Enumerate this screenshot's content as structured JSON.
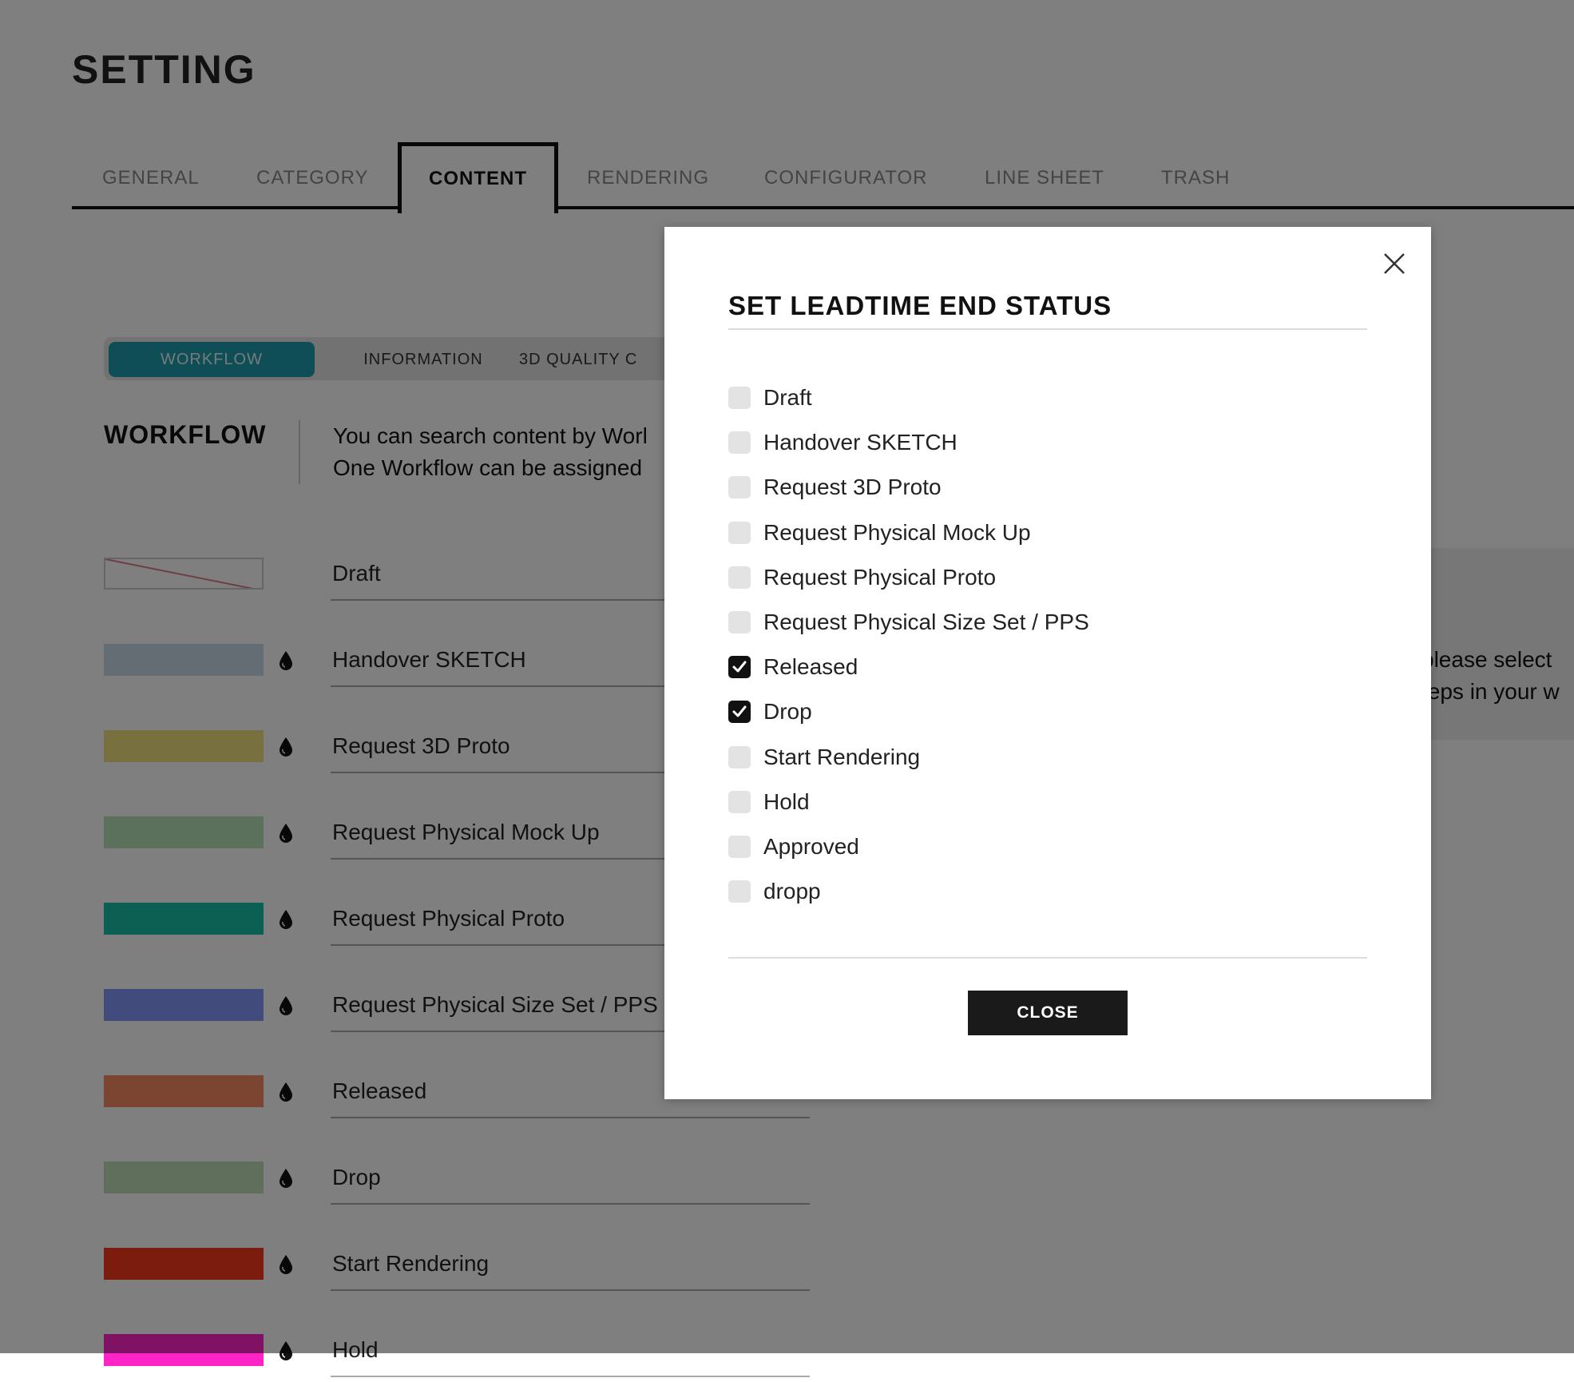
{
  "page": {
    "title": "SETTING"
  },
  "tabs": [
    {
      "label": "GENERAL"
    },
    {
      "label": "CATEGORY"
    },
    {
      "label": "CONTENT"
    },
    {
      "label": "RENDERING"
    },
    {
      "label": "CONFIGURATOR"
    },
    {
      "label": "LINE SHEET"
    },
    {
      "label": "TRASH"
    }
  ],
  "active_tab": "CONTENT",
  "subtabs": [
    {
      "label": "WORKFLOW"
    },
    {
      "label": "INFORMATION"
    },
    {
      "label": "3D QUALITY C"
    }
  ],
  "active_subtab": "WORKFLOW",
  "section": {
    "title": "WORKFLOW",
    "desc_line1": "You can search content by Worl",
    "desc_line2": "One Workflow can be assigned"
  },
  "info": {
    "line1": "please select",
    "line2": "teps in your w"
  },
  "workflow_items": [
    {
      "label": "Draft",
      "color": "#ffffff"
    },
    {
      "label": "Handover SKETCH",
      "color": "#c8d9e8"
    },
    {
      "label": "Request 3D Proto",
      "color": "#f1e07e"
    },
    {
      "label": "Request Physical Mock Up",
      "color": "#b6e3b6"
    },
    {
      "label": "Request Physical Proto",
      "color": "#18c0a6"
    },
    {
      "label": "Request Physical Size Set / PPS",
      "color": "#8298f9"
    },
    {
      "label": "Released",
      "color": "#f98a62"
    },
    {
      "label": "Drop",
      "color": "#c0dcb8"
    },
    {
      "label": "Start Rendering",
      "color": "#f8381e"
    },
    {
      "label": "Hold",
      "color": "#ff24c6"
    }
  ],
  "modal": {
    "title": "SET LEADTIME END STATUS",
    "options": [
      {
        "label": "Draft",
        "checked": false
      },
      {
        "label": "Handover SKETCH",
        "checked": false
      },
      {
        "label": "Request 3D Proto",
        "checked": false
      },
      {
        "label": "Request Physical Mock Up",
        "checked": false
      },
      {
        "label": "Request Physical Proto",
        "checked": false
      },
      {
        "label": "Request Physical Size Set / PPS",
        "checked": false
      },
      {
        "label": "Released",
        "checked": true
      },
      {
        "label": "Drop",
        "checked": true
      },
      {
        "label": "Start Rendering",
        "checked": false
      },
      {
        "label": "Hold",
        "checked": false
      },
      {
        "label": "Approved",
        "checked": false
      },
      {
        "label": "dropp",
        "checked": false
      }
    ],
    "close_label": "CLOSE"
  }
}
